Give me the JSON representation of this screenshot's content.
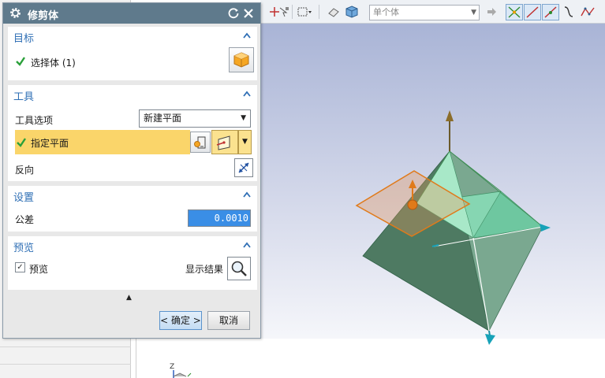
{
  "dialog": {
    "title": "修剪体",
    "groups": {
      "target": {
        "title": "目标",
        "select_body_label": "选择体 (1)"
      },
      "tool": {
        "title": "工具",
        "tool_option_label": "工具选项",
        "tool_option_value": "新建平面",
        "specify_plane_label": "指定平面",
        "reverse_label": "反向"
      },
      "settings": {
        "title": "设置",
        "tolerance_label": "公差",
        "tolerance_value": "0.0010"
      },
      "preview": {
        "title": "预览",
        "preview_label": "预览",
        "preview_checked": true,
        "show_result_label": "显示结果"
      }
    },
    "buttons": {
      "ok": "< 确定 >",
      "cancel": "取消"
    }
  },
  "toolbar": {
    "filter_value": "单个体"
  },
  "colors": {
    "title_bar": "#5f7a8c",
    "group_title": "#2f6fb5",
    "active_row": "#fad56a",
    "check_green": "#2aa03a",
    "selection_blue": "#3a8ee6"
  },
  "icons": [
    "gear-icon",
    "reset-icon",
    "close-icon",
    "check-icon",
    "solid-body-icon",
    "plane-dialog-icon",
    "plane-icon",
    "reverse-direction-icon",
    "magnifier-icon"
  ]
}
